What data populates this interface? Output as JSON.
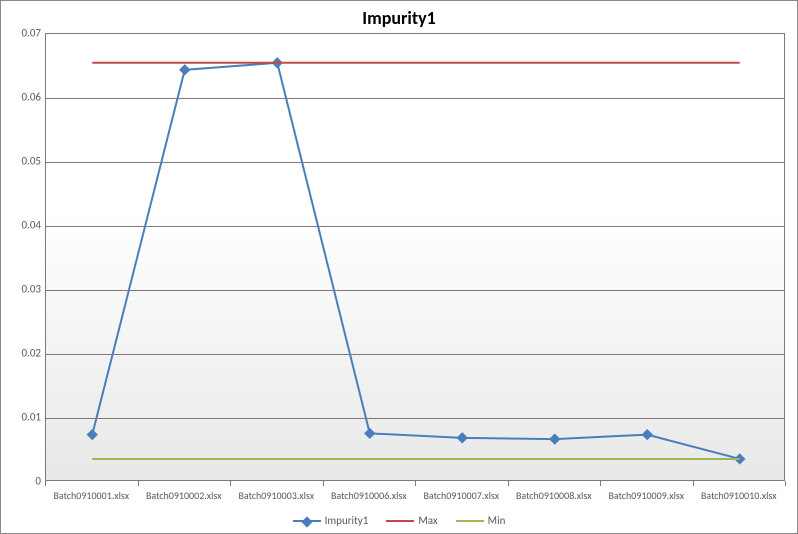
{
  "chart_data": {
    "type": "line",
    "title": "Impurity1",
    "categories": [
      "Batch0910001.xlsx",
      "Batch0910002.xlsx",
      "Batch0910003.xlsx",
      "Batch0910006.xlsx",
      "Batch0910007.xlsx",
      "Batch0910008.xlsx",
      "Batch0910009.xlsx",
      "Batch0910010.xlsx"
    ],
    "series": [
      {
        "name": "Impurity1",
        "values": [
          0.0074,
          0.0644,
          0.0655,
          0.0076,
          0.0069,
          0.0067,
          0.0074,
          0.0036
        ],
        "color": "#4a7ebb",
        "marker": true
      },
      {
        "name": "Max",
        "values": [
          0.0655,
          0.0655,
          0.0655,
          0.0655,
          0.0655,
          0.0655,
          0.0655,
          0.0655
        ],
        "color": "#be4b48",
        "marker": false
      },
      {
        "name": "Min",
        "values": [
          0.0036,
          0.0036,
          0.0036,
          0.0036,
          0.0036,
          0.0036,
          0.0036,
          0.0036
        ],
        "color": "#98b954",
        "marker": false
      }
    ],
    "ylim": [
      0,
      0.07
    ],
    "yticks": [
      0,
      0.01,
      0.02,
      0.03,
      0.04,
      0.05,
      0.06,
      0.07
    ],
    "xlabel": "",
    "ylabel": ""
  }
}
